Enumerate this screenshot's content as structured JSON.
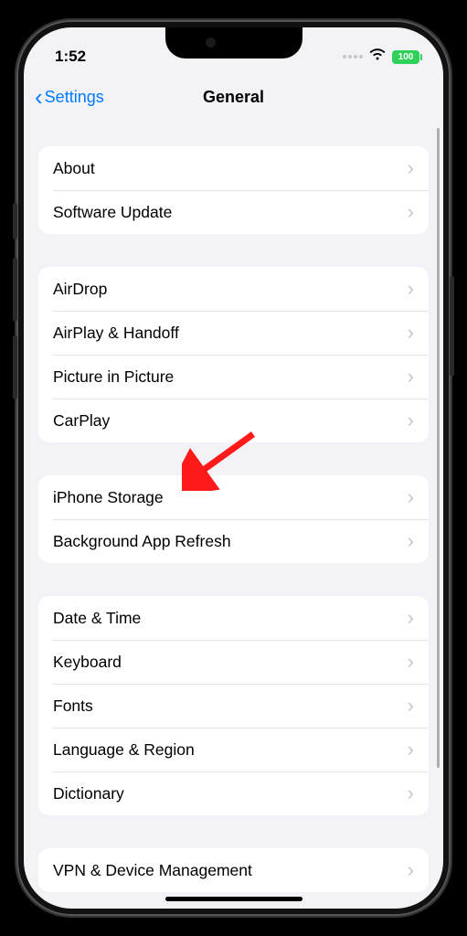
{
  "status": {
    "time": "1:52",
    "battery": "100"
  },
  "nav": {
    "back": "Settings",
    "title": "General"
  },
  "groups": [
    {
      "rows": [
        "About",
        "Software Update"
      ]
    },
    {
      "rows": [
        "AirDrop",
        "AirPlay & Handoff",
        "Picture in Picture",
        "CarPlay"
      ]
    },
    {
      "rows": [
        "iPhone Storage",
        "Background App Refresh"
      ]
    },
    {
      "rows": [
        "Date & Time",
        "Keyboard",
        "Fonts",
        "Language & Region",
        "Dictionary"
      ]
    },
    {
      "rows": [
        "VPN & Device Management"
      ]
    }
  ]
}
